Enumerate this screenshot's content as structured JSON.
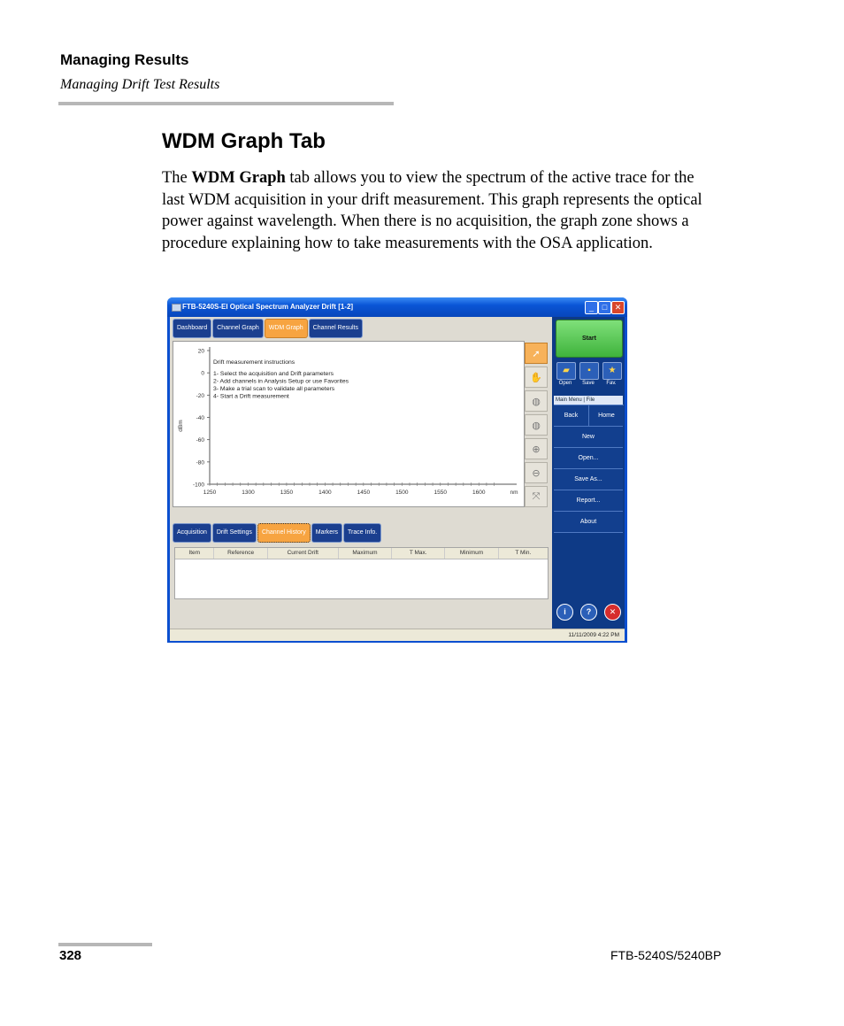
{
  "header": {
    "section": "Managing Results",
    "subsection": "Managing Drift Test Results"
  },
  "section_title": "WDM Graph Tab",
  "paragraph": {
    "lead": "The ",
    "bold": "WDM Graph",
    "rest": " tab allows you to view the spectrum of the active trace for the last WDM acquisition in your drift measurement. This graph represents the optical power against wavelength. When there is no acquisition, the graph zone shows a procedure explaining how to take measurements with the OSA application."
  },
  "window": {
    "title": "FTB-5240S-EI Optical Spectrum Analyzer Drift [1-2]",
    "controls": {
      "minimize": "_",
      "maximize": "□",
      "close": "✕"
    }
  },
  "top_tabs": [
    {
      "label": "Dashboard",
      "active": false
    },
    {
      "label": "Channel Graph",
      "active": false
    },
    {
      "label": "WDM Graph",
      "active": true
    },
    {
      "label": "Channel Results",
      "active": false
    }
  ],
  "graph": {
    "instructions": [
      "Drift measurement instructions",
      "",
      "1- Select the acquisition and Drift parameters",
      "2- Add channels in Analysis Setup or use Favorites",
      "3- Make a trial scan to validate all parameters",
      "4- Start a Drift measurement"
    ],
    "ylabel": "dBm",
    "xunit": "nm",
    "xticks": [
      "1250",
      "1300",
      "1350",
      "1400",
      "1450",
      "1500",
      "1550",
      "1600"
    ],
    "yticks": [
      "20",
      "0",
      "-20",
      "-40",
      "-60",
      "-80",
      "-100"
    ],
    "xlim": [
      1250,
      1640
    ],
    "ylim": [
      -100,
      20
    ]
  },
  "tools": [
    "cursor-icon",
    "hand-icon",
    "zoom-area-icon",
    "zoom-custom-icon",
    "zoom-in-icon",
    "zoom-out-icon",
    "fit-icon"
  ],
  "bottom_tabs": [
    {
      "label": "Acquisition",
      "active": false
    },
    {
      "label": "Drift Settings",
      "active": false
    },
    {
      "label": "Channel History",
      "active": true
    },
    {
      "label": "Markers",
      "active": false
    },
    {
      "label": "Trace Info.",
      "active": false
    }
  ],
  "table_headers": [
    "Item",
    "Reference",
    "Current Drift",
    "Maximum",
    "T Max.",
    "Minimum",
    "T Min."
  ],
  "right_panel": {
    "start": "Start",
    "quick": [
      {
        "label": "Open",
        "icon": "folder-icon"
      },
      {
        "label": "Save",
        "icon": "save-icon"
      },
      {
        "label": "Fav.",
        "icon": "star-icon"
      }
    ],
    "menu_header": "Main Menu | File",
    "back": "Back",
    "home": "Home",
    "items": [
      "New",
      "Open...",
      "Save As...",
      "Report...",
      "About"
    ]
  },
  "status": {
    "datetime": "11/11/2009 4:22 PM"
  },
  "footer": {
    "page": "328",
    "model": "FTB-5240S/5240BP"
  },
  "colors": {
    "active_tab": "#f7a441",
    "tab": "#1b3f8f",
    "start_button": "#3fb33c",
    "window_frame": "#0b4fd0"
  }
}
